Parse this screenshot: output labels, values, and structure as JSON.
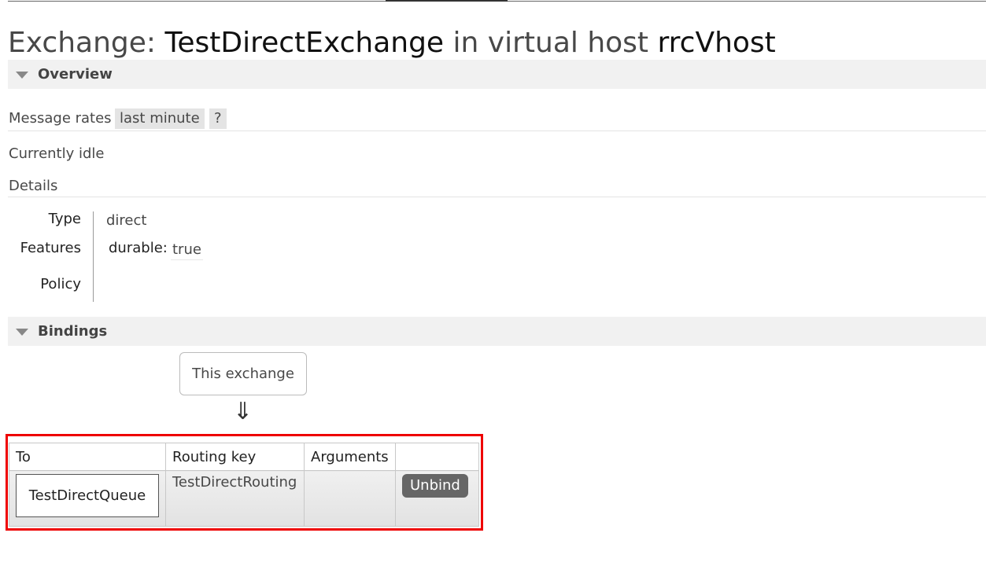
{
  "header": {
    "title_prefix": "Exchange: ",
    "exchange_name": "TestDirectExchange",
    "title_middle": " in virtual host ",
    "vhost_name": "rrcVhost"
  },
  "overview": {
    "section_label": "Overview",
    "message_rates_label": "Message rates",
    "rates_period": "last minute",
    "help_label": "?",
    "idle_text": "Currently idle",
    "details_label": "Details",
    "type_label": "Type",
    "type_value": "direct",
    "features_label": "Features",
    "durable_key": "durable:",
    "durable_value": "true",
    "policy_label": "Policy"
  },
  "bindings": {
    "section_label": "Bindings",
    "this_exchange_label": "This exchange",
    "arrow_glyph": "⇓",
    "columns": [
      "To",
      "Routing key",
      "Arguments",
      ""
    ],
    "rows": [
      {
        "to": "TestDirectQueue",
        "routing_key": "TestDirectRouting",
        "arguments": "",
        "action_label": "Unbind"
      }
    ]
  },
  "colors": {
    "highlight": "#ee0000",
    "section_bg": "#f1f1f1",
    "button_bg": "#666666"
  }
}
